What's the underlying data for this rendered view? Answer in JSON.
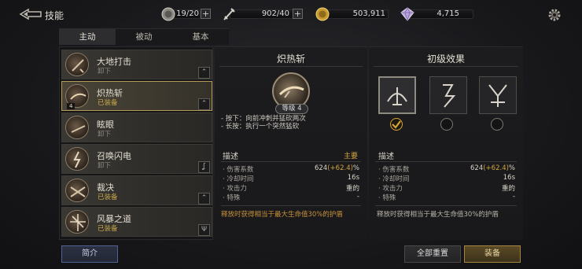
{
  "header": {
    "title": "技能",
    "back_icon": "back-arrow-icon",
    "resources": [
      {
        "icon": "stamina-coin-icon",
        "value": "19/20"
      },
      {
        "icon": "sword-icon",
        "value": "902/40"
      },
      {
        "icon": "gold-coin-icon",
        "value": "503,911"
      },
      {
        "icon": "crystal-icon",
        "value": "4,715"
      }
    ],
    "settings_icon": "gear-icon"
  },
  "tabs": [
    {
      "label": "主动",
      "active": true
    },
    {
      "label": "被动",
      "active": false
    },
    {
      "label": "基本",
      "active": false
    }
  ],
  "skills": [
    {
      "name": "大地打击",
      "status": "卸下",
      "equipped": false
    },
    {
      "name": "炽热斩",
      "status": "已装备",
      "equipped": true,
      "selected": true,
      "level": "4"
    },
    {
      "name": "眩眼",
      "status": "卸下",
      "equipped": false
    },
    {
      "name": "召唤闪电",
      "status": "卸下",
      "equipped": false
    },
    {
      "name": "裁决",
      "status": "已装备",
      "equipped": true
    },
    {
      "name": "风暴之道",
      "status": "已装备",
      "equipped": true
    }
  ],
  "detail": {
    "title": "炽热斩",
    "level_label": "等级 4",
    "desc_lines": [
      "- 按下：向前冲刺并猛砍两次",
      "- 长按：执行一个突然猛砍"
    ],
    "stats_header": "描述",
    "stats_tag": "主要",
    "stats": [
      {
        "label": "· 伤害系数",
        "value": "624",
        "inc": "(+62.4)",
        "unit": "%"
      },
      {
        "label": "· 冷却时间",
        "value": "16s"
      },
      {
        "label": "· 攻击力",
        "value": "重的"
      },
      {
        "label": "· 特殊",
        "value": "-"
      }
    ],
    "note": "释放时获得相当于最大生命值30%的护盾"
  },
  "effects": {
    "title": "初级效果",
    "options": [
      {
        "icon": "bow-rune-icon",
        "selected": true
      },
      {
        "icon": "hook-rune-icon",
        "selected": false
      },
      {
        "icon": "trident-rune-icon",
        "selected": false
      }
    ],
    "stats_header": "描述",
    "stats": [
      {
        "label": "· 伤害系数",
        "value": "624",
        "inc": "(+62.4)",
        "unit": "%"
      },
      {
        "label": "· 冷却时间",
        "value": "16s"
      },
      {
        "label": "· 攻击力",
        "value": "重的"
      },
      {
        "label": "· 特殊",
        "value": "-"
      }
    ],
    "note": "释放时获得相当于最大生命值30%的护盾"
  },
  "buttons": {
    "intro": "简介",
    "reset_all": "全部重置",
    "equip": "装备"
  },
  "colors": {
    "accent_gold": "#c9a84b",
    "increase": "#d3a53e",
    "note": "#c8923a"
  }
}
